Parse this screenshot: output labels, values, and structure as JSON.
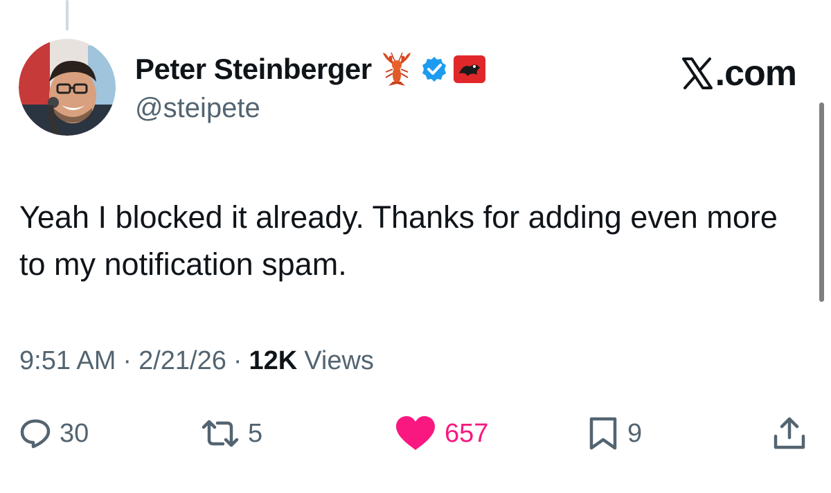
{
  "tweet": {
    "author": {
      "display_name": "Peter Steinberger",
      "handle": "@steipete",
      "verified": true,
      "badges": [
        "lobster-emoji",
        "verified-badge-icon",
        "affiliate-badge-icon"
      ]
    },
    "site_mark": ".com",
    "text": "Yeah I blocked it already. Thanks for adding even more to my notification spam.",
    "meta": {
      "time": "9:51 AM",
      "separator": "·",
      "date": "2/21/26",
      "views_count": "12K",
      "views_label": "Views"
    },
    "actions": {
      "replies": "30",
      "reposts": "5",
      "likes": "657",
      "bookmarks": "9"
    }
  },
  "colors": {
    "verified_blue": "#1d9bf0",
    "like_pink": "#f91880",
    "muted_text": "#536471",
    "primary_text": "#0f1419"
  },
  "icons": {
    "reply": "speech-bubble-icon",
    "repost": "repost-arrows-icon",
    "like": "heart-icon",
    "bookmark": "bookmark-icon",
    "share": "share-icon"
  }
}
